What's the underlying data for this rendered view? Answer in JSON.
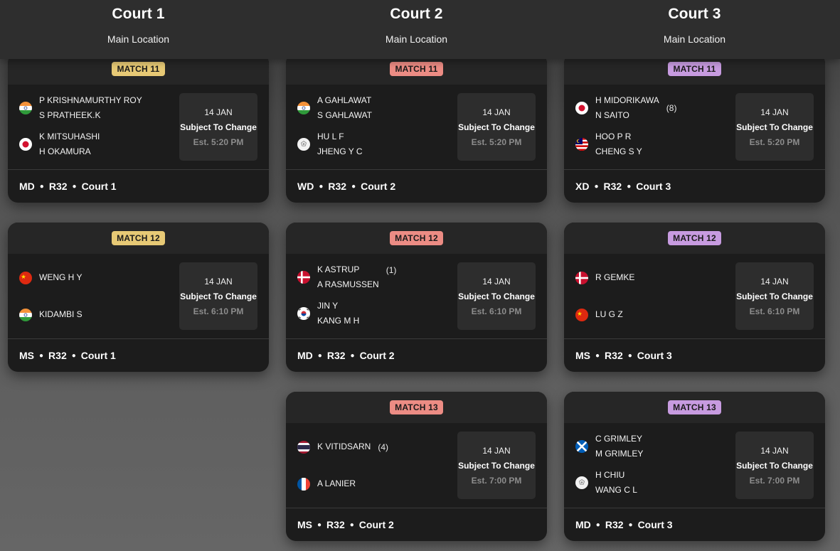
{
  "courts": [
    {
      "name": "Court 1",
      "location": "Main Location"
    },
    {
      "name": "Court 2",
      "location": "Main Location"
    },
    {
      "name": "Court 3",
      "location": "Main Location"
    }
  ],
  "colors": {
    "court1_badge": "#e7c975",
    "court2_badge": "#ec8c84",
    "court3_badge": "#c79be0"
  },
  "icons": {
    "flag_india": "india-flag-icon",
    "flag_japan": "japan-flag-icon",
    "flag_taipei": "chinese-taipei-flag-icon",
    "flag_malaysia": "malaysia-flag-icon",
    "flag_china": "china-flag-icon",
    "flag_denmark": "denmark-flag-icon",
    "flag_korea": "korea-flag-icon",
    "flag_thailand": "thailand-flag-icon",
    "flag_france": "france-flag-icon",
    "flag_scotland": "scotland-flag-icon"
  },
  "matches": {
    "c1m11": {
      "badge": "MATCH 11",
      "t1": [
        "P KRISHNAMURTHY ROY",
        "S PRATHEEK.K"
      ],
      "t2": [
        "K MITSUHASHI",
        "H OKAMURA"
      ],
      "date": "14 JAN",
      "status": "Subject To Change",
      "est": "Est. 5:20 PM",
      "event": "MD",
      "round": "R32",
      "court": "Court 1"
    },
    "c1m12": {
      "badge": "MATCH 12",
      "t1": [
        "WENG H Y"
      ],
      "t2": [
        "KIDAMBI S"
      ],
      "date": "14 JAN",
      "status": "Subject To Change",
      "est": "Est. 6:10 PM",
      "event": "MS",
      "round": "R32",
      "court": "Court 1"
    },
    "c2m11": {
      "badge": "MATCH 11",
      "t1": [
        "A GAHLAWAT",
        "S GAHLAWAT"
      ],
      "t2": [
        "HU L F",
        "JHENG Y C"
      ],
      "date": "14 JAN",
      "status": "Subject To Change",
      "est": "Est. 5:20 PM",
      "event": "WD",
      "round": "R32",
      "court": "Court 2"
    },
    "c2m12": {
      "badge": "MATCH 12",
      "t1": [
        "K ASTRUP",
        "A RASMUSSEN"
      ],
      "t1seed": "(1)",
      "t2": [
        "JIN Y",
        "KANG M H"
      ],
      "date": "14 JAN",
      "status": "Subject To Change",
      "est": "Est. 6:10 PM",
      "event": "MD",
      "round": "R32",
      "court": "Court 2"
    },
    "c2m13": {
      "badge": "MATCH 13",
      "t1": [
        "K VITIDSARN"
      ],
      "t1seed": "(4)",
      "t2": [
        "A LANIER"
      ],
      "date": "14 JAN",
      "status": "Subject To Change",
      "est": "Est. 7:00 PM",
      "event": "MS",
      "round": "R32",
      "court": "Court 2"
    },
    "c3m11": {
      "badge": "MATCH 11",
      "t1": [
        "H MIDORIKAWA",
        "N SAITO"
      ],
      "t1seed": "(8)",
      "t2": [
        "HOO P R",
        "CHENG S Y"
      ],
      "date": "14 JAN",
      "status": "Subject To Change",
      "est": "Est. 5:20 PM",
      "event": "XD",
      "round": "R32",
      "court": "Court 3"
    },
    "c3m12": {
      "badge": "MATCH 12",
      "t1": [
        "R GEMKE"
      ],
      "t2": [
        "LU G Z"
      ],
      "date": "14 JAN",
      "status": "Subject To Change",
      "est": "Est. 6:10 PM",
      "event": "MS",
      "round": "R32",
      "court": "Court 3"
    },
    "c3m13": {
      "badge": "MATCH 13",
      "t1": [
        "C GRIMLEY",
        "M GRIMLEY"
      ],
      "t2": [
        "H CHIU",
        "WANG C L"
      ],
      "date": "14 JAN",
      "status": "Subject To Change",
      "est": "Est. 7:00 PM",
      "event": "MD",
      "round": "R32",
      "court": "Court 3"
    }
  }
}
